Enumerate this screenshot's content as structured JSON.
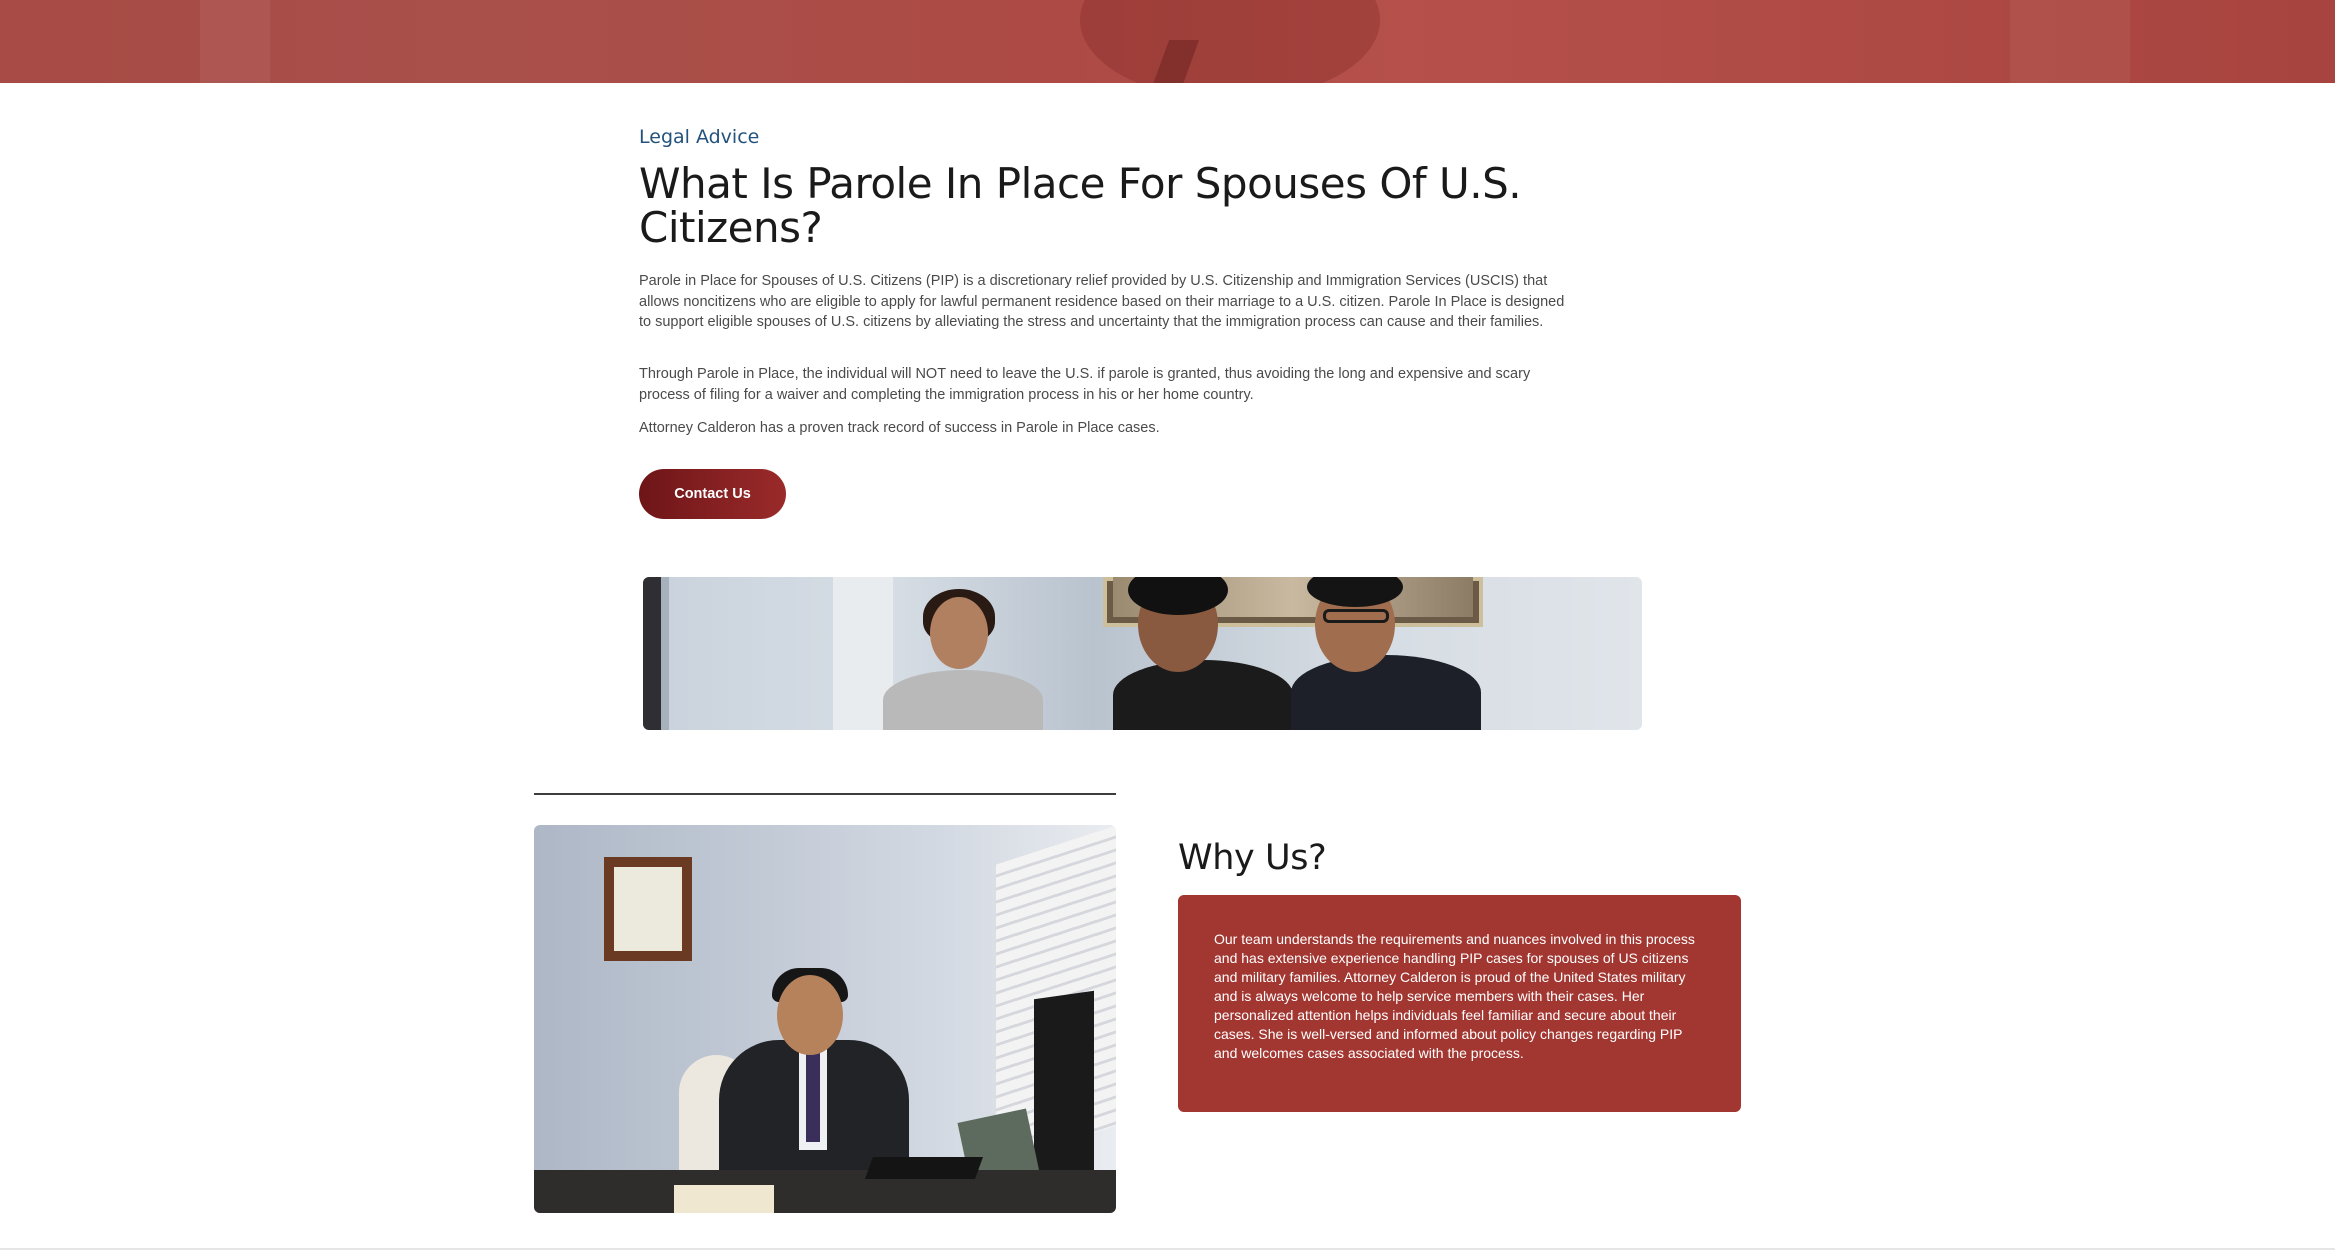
{
  "article": {
    "category": "Legal Advice",
    "title": "What Is Parole In Place For Spouses Of U.S. Citizens?",
    "paragraphs": [
      "Parole in Place for Spouses of U.S. Citizens (PIP) is a discretionary relief provided by U.S. Citizenship and Immigration Services (USCIS) that allows noncitizens who are eligible to apply for lawful permanent residence based on their marriage to a U.S. citizen. Parole In Place is designed to support eligible spouses of U.S. citizens by alleviating the stress and uncertainty that the immigration process can cause and their families.",
      "Through Parole in Place, the individual will NOT need to leave the U.S. if parole is granted, thus avoiding the long and expensive and scary process of filing for a waiver and completing the immigration process in his or her home country.",
      "Attorney Calderon has a proven track record of success in Parole in Place cases."
    ],
    "cta_label": "Contact Us"
  },
  "why_us": {
    "title": "Why Us?",
    "body": "Our team understands the requirements and nuances involved in this process and has extensive experience handling PIP cases for spouses of US citizens and military families. Attorney Calderon is proud of the United States military and is always welcome to help service members with their cases. Her personalized attention helps individuals feel familiar and secure about their cases. She is well-versed and informed about policy changes regarding PIP and welcomes cases associated with the process."
  },
  "colors": {
    "accent": "#a23631",
    "button_start": "#6e1518",
    "button_end": "#9a2a2a",
    "eyebrow": "#23527c",
    "hero_band": "#a84a45"
  }
}
